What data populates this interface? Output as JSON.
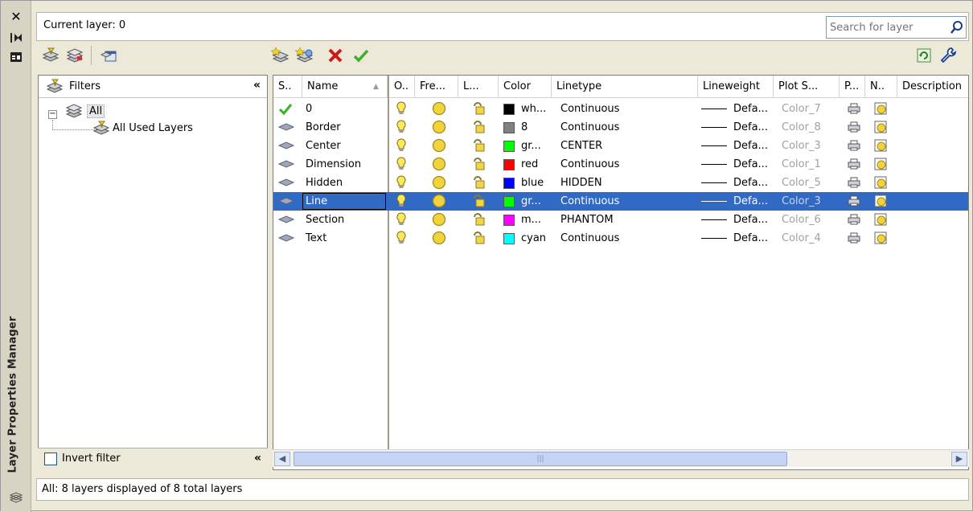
{
  "window": {
    "title": "Layer Properties Manager",
    "current_layer": "Current layer: 0",
    "search_placeholder": "Search for layer"
  },
  "filters": {
    "header": "Filters",
    "tree": [
      {
        "label": "All",
        "expanded": true
      },
      {
        "label": "All Used Layers"
      }
    ],
    "invert_filter_label": "Invert filter",
    "invert_filter_checked": false
  },
  "columns": [
    {
      "label": "S.."
    },
    {
      "label": "Name"
    },
    {
      "label": "O.."
    },
    {
      "label": "Fre..."
    },
    {
      "label": "L..."
    },
    {
      "label": "Color"
    },
    {
      "label": "Linetype"
    },
    {
      "label": "Lineweight"
    },
    {
      "label": "Plot S..."
    },
    {
      "label": "P..."
    },
    {
      "label": "N.."
    },
    {
      "label": "Description"
    }
  ],
  "layers": [
    {
      "name": "0",
      "color_name": "wh...",
      "color_hex": "#000000",
      "linetype": "Continuous",
      "lineweight": "Defa...",
      "plot_style": "Color_7",
      "current": true,
      "selected": false
    },
    {
      "name": "Border",
      "color_name": "8",
      "color_hex": "#808080",
      "linetype": "Continuous",
      "lineweight": "Defa...",
      "plot_style": "Color_8",
      "current": false,
      "selected": false
    },
    {
      "name": "Center",
      "color_name": "gr...",
      "color_hex": "#00ff00",
      "linetype": "CENTER",
      "lineweight": "Defa...",
      "plot_style": "Color_3",
      "current": false,
      "selected": false
    },
    {
      "name": "Dimension",
      "color_name": "red",
      "color_hex": "#ff0000",
      "linetype": "Continuous",
      "lineweight": "Defa...",
      "plot_style": "Color_1",
      "current": false,
      "selected": false
    },
    {
      "name": "Hidden",
      "color_name": "blue",
      "color_hex": "#0000ff",
      "linetype": "HIDDEN",
      "lineweight": "Defa...",
      "plot_style": "Color_5",
      "current": false,
      "selected": false
    },
    {
      "name": "Line",
      "color_name": "gr...",
      "color_hex": "#00ff00",
      "linetype": "Continuous",
      "lineweight": "Defa...",
      "plot_style": "Color_3",
      "current": false,
      "selected": true
    },
    {
      "name": "Section",
      "color_name": "m...",
      "color_hex": "#ff00ff",
      "linetype": "PHANTOM",
      "lineweight": "Defa...",
      "plot_style": "Color_6",
      "current": false,
      "selected": false
    },
    {
      "name": "Text",
      "color_name": "cyan",
      "color_hex": "#00ffff",
      "linetype": "Continuous",
      "lineweight": "Defa...",
      "plot_style": "Color_4",
      "current": false,
      "selected": false
    }
  ],
  "status": {
    "text": "All: 8 layers displayed of 8 total layers"
  },
  "icons": {
    "close": "close-icon",
    "autohide": "autohide-icon",
    "properties": "properties-icon",
    "new_property_filter": "new-property-filter-icon",
    "new_group_filter": "new-group-filter-icon",
    "layer_states": "layer-states-icon",
    "new_layer": "new-layer-icon",
    "new_layer_vp_frozen": "new-layer-vp-frozen-icon",
    "delete_layer": "delete-layer-icon",
    "set_current": "set-current-icon",
    "refresh": "refresh-icon",
    "settings": "settings-icon",
    "search": "search-icon"
  },
  "colors": {
    "selection": "#316ac5",
    "current_check": "#3cb02a",
    "delete_x": "#cc1a1a",
    "bulb": "#ffe95a",
    "sun": "#f2d43a"
  }
}
